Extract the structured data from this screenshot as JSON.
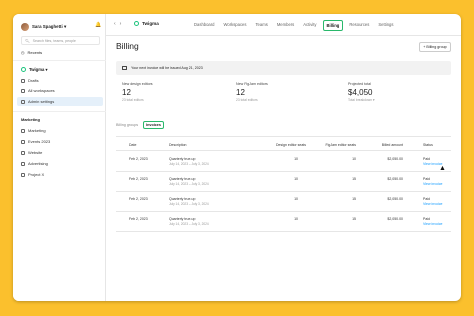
{
  "sidebar": {
    "user_name": "Sara Spaghetti ▾",
    "search_placeholder": "Search files, teams, people",
    "recents": "Recents",
    "team": "Twigma ▾",
    "items": [
      "Drafts",
      "All workspaces",
      "Admin settings"
    ],
    "section_title": "Marketing",
    "section_items": [
      "Marketing",
      "Events 2023",
      "Website",
      "Advertising",
      "Project X"
    ]
  },
  "topbar": {
    "back": "‹",
    "forward": "›",
    "team_name": "Twigma",
    "tabs": [
      "Dashboard",
      "Workspaces",
      "Teams",
      "Members",
      "Activity",
      "Billing",
      "Resources",
      "Settings"
    ],
    "active_tab": "Billing"
  },
  "main": {
    "title": "Billing",
    "billing_group_button": "+ Billing group",
    "banner": "Your next invoice will be issued Aug 21, 2023",
    "stats": [
      {
        "label": "New design editors",
        "value": "12",
        "sub": "23 total editors"
      },
      {
        "label": "New FigJam editors",
        "value": "12",
        "sub": "23 total editors"
      },
      {
        "label": "Projected total",
        "value": "$4,050",
        "sub": "Total breakdown ▾"
      }
    ],
    "subtabs": [
      "Billing groups",
      "Invoices"
    ],
    "active_subtab": "Invoices"
  },
  "table": {
    "headers": [
      "Date",
      "Description",
      "Design editor seats",
      "FigJam editor seats",
      "Billed amount",
      "Status"
    ],
    "rows": [
      {
        "date": "Feb 2, 2023",
        "desc": "Quarterly true-up",
        "range": "July 14, 2023 – July 3, 2024",
        "design": "10",
        "figjam": "10",
        "amount": "$2,050.00",
        "status": "Paid",
        "link": "View invoice"
      },
      {
        "date": "Feb 2, 2023",
        "desc": "Quarterly true-up",
        "range": "July 14, 2023 – July 3, 2024",
        "design": "10",
        "figjam": "15",
        "amount": "$2,050.00",
        "status": "Paid",
        "link": "View invoice"
      },
      {
        "date": "Feb 2, 2023",
        "desc": "Quarterly true-up",
        "range": "July 14, 2023 – July 3, 2024",
        "design": "10",
        "figjam": "15",
        "amount": "$2,050.00",
        "status": "Paid",
        "link": "View invoice"
      },
      {
        "date": "Feb 2, 2023",
        "desc": "Quarterly true-up",
        "range": "July 14, 2023 – July 3, 2024",
        "design": "10",
        "figjam": "15",
        "amount": "$2,050.00",
        "status": "Paid",
        "link": "View invoice"
      }
    ]
  },
  "colors": {
    "background": "#fbc02d",
    "accent_green": "#29b86b",
    "link_blue": "#0d99ff"
  }
}
